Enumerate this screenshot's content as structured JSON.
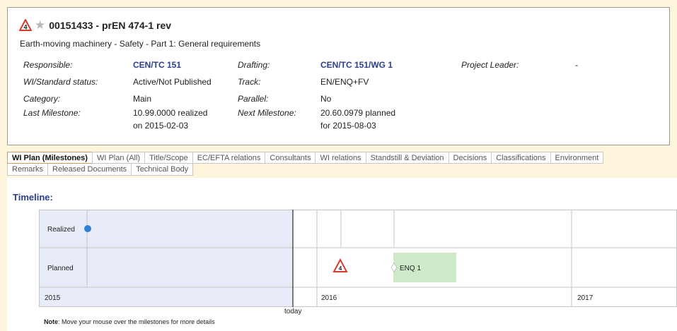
{
  "header": {
    "badge_number": "4",
    "title": "00151433 - prEN 474-1 rev",
    "subtitle": "Earth-moving machinery - Safety - Part 1: General requirements"
  },
  "details": {
    "responsible_label": "Responsible:",
    "responsible_value": "CEN/TC 151",
    "drafting_label": "Drafting:",
    "drafting_value": "CEN/TC 151/WG 1",
    "project_leader_label": "Project Leader:",
    "project_leader_value": "-",
    "status_label": "WI/Standard status:",
    "status_value": "Active/Not Published",
    "track_label": "Track:",
    "track_value": "EN/ENQ+FV",
    "category_label": "Category:",
    "category_value": "Main",
    "parallel_label": "Parallel:",
    "parallel_value": "No",
    "last_milestone_label": "Last Milestone:",
    "last_milestone_line1": "10.99.0000 realized",
    "last_milestone_line2": "on 2015-02-03",
    "next_milestone_label": "Next Milestone:",
    "next_milestone_line1": "20.60.0979 planned",
    "next_milestone_line2": "for 2015-08-03"
  },
  "tabs_row1": [
    "WI Plan (Milestones)",
    "WI Plan (All)",
    "Title/Scope",
    "EC/EFTA relations",
    "Consultants",
    "WI relations",
    "Standstill & Deviation",
    "Decisions",
    "Classifications",
    "Environment"
  ],
  "tabs_row2": [
    "Remarks",
    "Released Documents",
    "Technical Body"
  ],
  "timeline": {
    "heading": "Timeline:",
    "row_realized": "Realized",
    "row_planned": "Planned",
    "year_2015": "2015",
    "year_2016": "2016",
    "year_2017": "2017",
    "enq_label": "ENQ 1",
    "badge_number": "4",
    "today_label": "today"
  },
  "note": {
    "bold": "Note",
    "text": ": Move your mouse over the milestones for more details"
  },
  "colors": {
    "link": "#2b3d8f",
    "past_shade": "#e8ecf8",
    "enq_bar": "#cde9c8",
    "realized_dot": "#2f7fd6",
    "warning_red": "#d93a2b"
  }
}
